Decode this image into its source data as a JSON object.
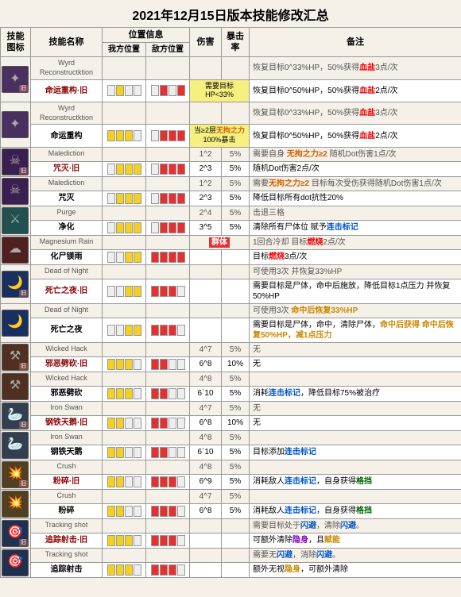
{
  "title": "2021年12月15日版本技能修改汇总",
  "headers": {
    "icon": "技能\n图标",
    "name": "技能名称",
    "position": "位置信息",
    "my_pos": "我方位置",
    "enemy_pos": "敌方位置",
    "damage": "伤害",
    "crit": "暴击率",
    "note": "备注"
  },
  "rows": [
    {
      "type": "en",
      "icon": "wyrd",
      "name_en": "Wyrd Reconstructktion",
      "my": "",
      "enemy": "",
      "dmg": "",
      "crit": "",
      "note": "恢复目标0^33%HP，50%获得血盐3点/次",
      "note_colored": true
    },
    {
      "type": "cn",
      "icon": "wyrd",
      "name_cn": "命运重构·旧",
      "my": "y2",
      "enemy": "r24",
      "dmg": "需要目标HP<33%",
      "dmg_colored": false,
      "dmg_special": true,
      "crit": "",
      "note": "恢复目标0^50%HP，50%获得血盐2点/次",
      "note_colored": true
    },
    {
      "type": "en",
      "icon": "wyrd",
      "name_en": "Wyrd Reconstructktion",
      "my": "",
      "enemy": "",
      "dmg": "",
      "crit": "",
      "note": "恢复目标0^33%HP，50%获得血盐3点/次",
      "note_colored": true
    },
    {
      "type": "cn",
      "icon": "wyrd",
      "name_cn": "命运重构",
      "my": "y123",
      "enemy": "r234",
      "dmg": "当≥2层无拘之力100%暴击",
      "dmg_special2": true,
      "crit": "",
      "note": "恢复目标0^50%HP，50%获得血盐2点/次",
      "note_colored": true
    },
    {
      "type": "en",
      "icon": "malediction",
      "name_en": "Malediction",
      "my": "",
      "enemy": "",
      "dmg": "1^2",
      "crit": "5%",
      "note": "需要自身 无拘之力≥2 随机Dot伤害1点/次",
      "note_has_color": true
    },
    {
      "type": "cn",
      "icon": "malediction",
      "name_cn": "咒灭·旧",
      "my": "y234",
      "enemy": "r234",
      "dmg": "2^3",
      "crit": "5%",
      "note": "随机Dot伤害2点/次",
      "note_has_color": false
    },
    {
      "type": "en",
      "icon": "malediction",
      "name_en": "Malediction",
      "my": "",
      "enemy": "",
      "dmg": "1^2",
      "crit": "5%",
      "note": "需要无拘之力≥2 目标每次受伤获得随机Dot伤害1点/次"
    },
    {
      "type": "cn",
      "icon": "malediction",
      "name_cn": "咒灭",
      "my": "y234",
      "enemy": "r234",
      "dmg": "2^3",
      "crit": "5%",
      "note": "降低目标所有dot抗性20%"
    },
    {
      "type": "en",
      "icon": "purge",
      "name_en": "Purge",
      "my": "",
      "enemy": "",
      "dmg": "2^4",
      "crit": "5%",
      "note": "击退三格"
    },
    {
      "type": "cn",
      "icon": "purge",
      "name_cn": "净化",
      "my": "y234",
      "enemy": "r234",
      "dmg": "3^5",
      "crit": "5%",
      "note": "清除所有尸体位 赋予连击标记"
    },
    {
      "type": "en",
      "icon": "magrain",
      "name_en": "Magnesium Rain",
      "my": "",
      "enemy": "",
      "dmg": "群体",
      "crit": "",
      "note_special": "群体",
      "note": "1回合冷却 目标燃烧2点/次"
    },
    {
      "type": "cn",
      "icon": "magrain",
      "name_cn": "化尸镁雨",
      "my": "y34",
      "enemy": "r1234",
      "dmg": "",
      "crit": "",
      "note": "目标燃烧3点/次"
    },
    {
      "type": "en",
      "icon": "deadnight",
      "name_en": "Dead of Night",
      "my": "",
      "enemy": "",
      "dmg": "",
      "crit": "",
      "note": "可使用3次 并恢复33%HP"
    },
    {
      "type": "cn",
      "icon": "deadnight",
      "name_cn": "死亡之夜·旧",
      "my": "y34",
      "enemy": "r123",
      "dmg": "",
      "crit": "",
      "note": "需要目标是尸体，命中后施放，降低目标1点压力 并恢复50%HP"
    },
    {
      "type": "en",
      "icon": "deadnight",
      "name_en": "Dead of Night",
      "my": "",
      "enemy": "",
      "dmg": "",
      "crit": "",
      "note": "可使用3次 命中后恢复33%HP"
    },
    {
      "type": "cn",
      "icon": "deadnight",
      "name_cn": "死亡之夜",
      "my": "y34",
      "enemy": "r123",
      "dmg": "",
      "crit": "",
      "note": "需要目标是尸体，命中，清除尸体，命中后获得 命中后恢复50%HP，减1点压力"
    },
    {
      "type": "en",
      "icon": "wickedhack",
      "name_en": "Wicked Hack",
      "my": "",
      "enemy": "",
      "dmg": "4^7",
      "crit": "5%",
      "note": "无"
    },
    {
      "type": "cn",
      "icon": "wickedhack",
      "name_cn": "邪恶劈砍·旧",
      "my": "y123",
      "enemy": "r12",
      "dmg": "6^8",
      "crit": "10%",
      "note": "无"
    },
    {
      "type": "en",
      "icon": "wickedhack",
      "name_en": "Wicked Hack",
      "my": "",
      "enemy": "",
      "dmg": "4^8",
      "crit": "5%",
      "note": ""
    },
    {
      "type": "cn",
      "icon": "wickedhack",
      "name_cn": "邪恶劈砍",
      "my": "y123",
      "enemy": "r12",
      "dmg": "6^10",
      "crit": "5%",
      "note": "消耗连击标记，降低目标75%被治疗"
    },
    {
      "type": "en",
      "icon": "ironswan",
      "name_en": "Iron Swan",
      "my": "",
      "enemy": "",
      "dmg": "4^7",
      "crit": "5%",
      "note": "无"
    },
    {
      "type": "cn",
      "icon": "ironswan",
      "name_cn": "钢铁天鹅·旧",
      "my": "y12",
      "enemy": "r12",
      "dmg": "6^8",
      "crit": "10%",
      "note": "无"
    },
    {
      "type": "en",
      "icon": "ironswan",
      "name_en": "Iron Swan",
      "my": "",
      "enemy": "",
      "dmg": "4^8",
      "crit": "5%",
      "note": ""
    },
    {
      "type": "cn",
      "icon": "ironswan",
      "name_cn": "钢铁天鹅",
      "my": "y12",
      "enemy": "r12",
      "dmg": "6^10",
      "crit": "5%",
      "note": "目标添加连击标记"
    },
    {
      "type": "en",
      "icon": "crush",
      "name_en": "Crush",
      "my": "",
      "enemy": "",
      "dmg": "4^8",
      "crit": "5%",
      "note": ""
    },
    {
      "type": "cn",
      "icon": "crush",
      "name_cn": "粉碎·旧",
      "my": "y12",
      "enemy": "r123",
      "dmg": "6^9",
      "crit": "5%",
      "note": "消耗敌人连击标记，自身获得格挡"
    },
    {
      "type": "en",
      "icon": "crush",
      "name_en": "Crush",
      "my": "",
      "enemy": "",
      "dmg": "4^7",
      "crit": "5%",
      "note": ""
    },
    {
      "type": "cn",
      "icon": "crush",
      "name_cn": "粉碎",
      "my": "y12",
      "enemy": "r123",
      "dmg": "6^8",
      "crit": "5%",
      "note": "消耗敌人连击标记，自身获得格挡"
    },
    {
      "type": "en",
      "icon": "tracking",
      "name_en": "Tracking shot",
      "my": "",
      "enemy": "",
      "dmg": "",
      "crit": "",
      "note": "需要目标处于闪避，清除闪避。"
    },
    {
      "type": "cn",
      "icon": "tracking",
      "name_cn": "追踪射击·旧",
      "my": "y123",
      "enemy": "r123",
      "dmg": "",
      "crit": "",
      "note": "可额外清除隐身，且赋能"
    },
    {
      "type": "en",
      "icon": "tracking",
      "name_en": "Tracking shot",
      "my": "",
      "enemy": "",
      "dmg": "",
      "crit": "",
      "note": "需要无闪避，消除闪避。"
    },
    {
      "type": "cn",
      "icon": "tracking",
      "name_cn": "追踪射击",
      "my": "y123",
      "enemy": "r123",
      "dmg": "",
      "crit": "",
      "note": "额外无视隐身，可额外清除"
    }
  ]
}
